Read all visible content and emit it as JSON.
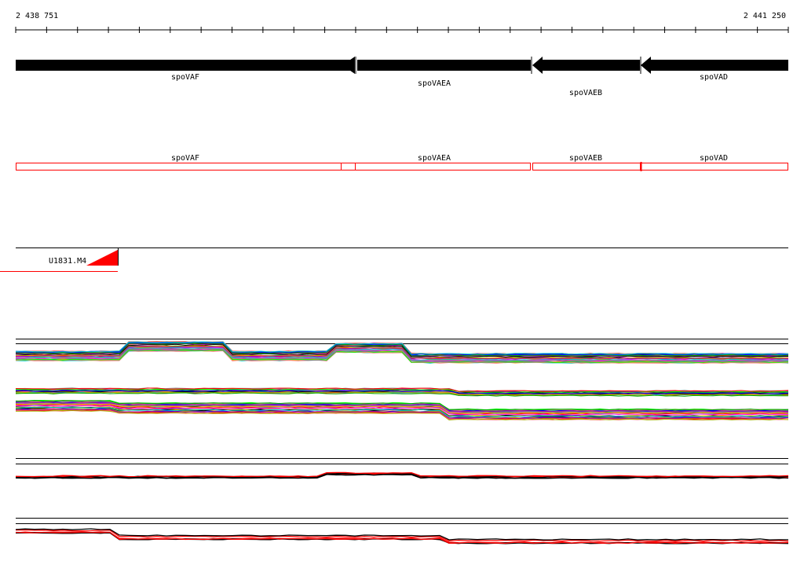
{
  "coords": {
    "start": "2 438 751",
    "end": "2 441 250"
  },
  "genes": [
    {
      "name": "spoVAF",
      "label": "spoVAF"
    },
    {
      "name": "spoVAEA",
      "label": "spoVAEA"
    },
    {
      "name": "spoVAEB",
      "label": "spoVAEB"
    },
    {
      "name": "spoVAD",
      "label": "spoVAD"
    }
  ],
  "regions": [
    {
      "label": "spoVAF"
    },
    {
      "label": "spoVAEA"
    },
    {
      "label": "spoVAEB"
    },
    {
      "label": "spoVAD"
    }
  ],
  "track": {
    "name": "U1831.M4"
  },
  "colors": {
    "gene": "#000000",
    "region": "#ff0000",
    "palette": [
      "#000000",
      "#ff0000",
      "#00aa00",
      "#0000ff",
      "#ff00ff",
      "#00cccc",
      "#ffaa00",
      "#888888",
      "#aaaa00",
      "#aa00aa",
      "#00ff00",
      "#ff8888"
    ]
  }
}
